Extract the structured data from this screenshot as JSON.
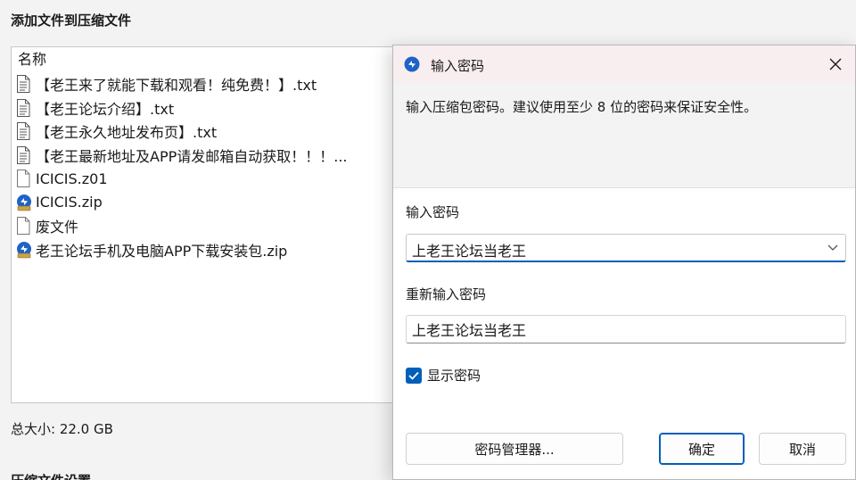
{
  "window": {
    "title": "添加文件到压缩文件",
    "list_header": "名称",
    "total_size": "总大小: 22.0 GB",
    "next_section": "压缩文件设置"
  },
  "files": [
    {
      "name": "【老王来了就能下载和观看！纯免费！】.txt",
      "icon": "text-file-icon"
    },
    {
      "name": "【老王论坛介绍】.txt",
      "icon": "text-file-icon"
    },
    {
      "name": "【老王永久地址发布页】.txt",
      "icon": "text-file-icon"
    },
    {
      "name": "【老王最新地址及APP请发邮箱自动获取！！！...",
      "icon": "text-file-icon"
    },
    {
      "name": "ICICIS.z01",
      "icon": "blank-file-icon"
    },
    {
      "name": "ICICIS.zip",
      "icon": "archive-icon"
    },
    {
      "name": "废文件",
      "icon": "blank-file-icon"
    },
    {
      "name": "老王论坛手机及电脑APP下载安装包.zip",
      "icon": "archive-icon"
    }
  ],
  "dialog": {
    "title": "输入密码",
    "description": "输入压缩包密码。建议使用至少 8 位的密码来保证安全性。",
    "password_label": "输入密码",
    "password_value": "上老王论坛当老王",
    "confirm_label": "重新输入密码",
    "confirm_value": "上老王论坛当老王",
    "show_password_label": "显示密码",
    "show_password_checked": true,
    "manager_button": "密码管理器...",
    "ok_button": "确定",
    "cancel_button": "取消"
  },
  "colors": {
    "accent": "#005fb8",
    "titlebar": "#f8eef0"
  }
}
